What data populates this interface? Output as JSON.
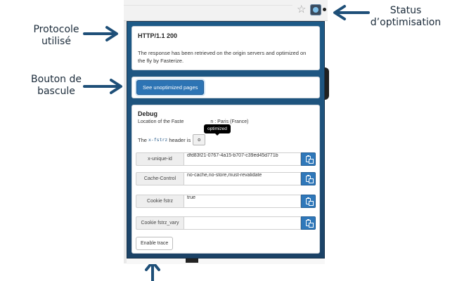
{
  "annotations": {
    "protocol": [
      "Protocole",
      "utilisé"
    ],
    "toggle": [
      "Bouton de",
      "bascule"
    ],
    "status": [
      "Status",
      "d’optimisation"
    ]
  },
  "icons": {
    "browser_star": "star-icon",
    "extension": "fasterize-extension-icon",
    "copy": "clipboard-icon"
  },
  "colors": {
    "popup_gradient_top": "#1d5a87",
    "popup_gradient_bottom": "#1b4266",
    "primary_button": "#2d74b4",
    "arrow": "#1e4f78"
  },
  "protocol_panel": {
    "title": "HTTP/1.1 200",
    "message": "The response has been retrieved on the origin servers and optimized on the fly by Fasterize."
  },
  "toggle_panel": {
    "button_label": "See unoptimized pages"
  },
  "debug_panel": {
    "title": "Debug",
    "location_prefix": "Location of the Faste",
    "location_suffix": "n : Paris (France)",
    "tooltip": "optimized",
    "header_prefix": "The",
    "header_name": "x-fstrz",
    "header_suffix": "header is",
    "header_value": "o",
    "fields": [
      {
        "label": "x-unique-id",
        "value": "dfd83f21-0767-4a15-b707-c39ed45d771b"
      },
      {
        "label": "Cache-Control",
        "value": "no-cache,no-store,must-revalidate"
      },
      {
        "label": "Cookie fstrz",
        "value": "true"
      },
      {
        "label": "Cookie fstrz_vary",
        "value": ""
      }
    ],
    "trace_button": "Enable trace"
  }
}
